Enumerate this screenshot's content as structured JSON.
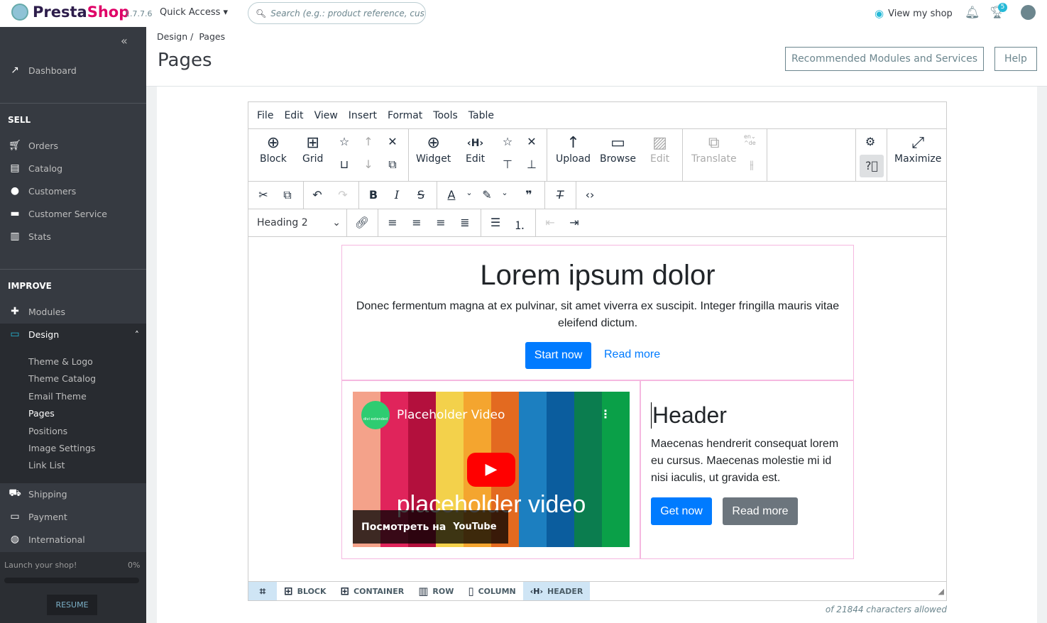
{
  "header": {
    "brand_a": "Presta",
    "brand_b": "Shop",
    "version": "1.7.7.6",
    "quick_access": "Quick Access",
    "search_placeholder": "Search (e.g.: product reference, customer name…)",
    "view_shop": "View my shop",
    "notif_count": "5"
  },
  "sidebar": {
    "dashboard": "Dashboard",
    "sell": "SELL",
    "sell_items": [
      "Orders",
      "Catalog",
      "Customers",
      "Customer Service",
      "Stats"
    ],
    "improve": "IMPROVE",
    "modules": "Modules",
    "design": "Design",
    "design_sub": [
      "Theme & Logo",
      "Theme Catalog",
      "Email Theme",
      "Pages",
      "Positions",
      "Image Settings",
      "Link List"
    ],
    "more": [
      "Shipping",
      "Payment",
      "International"
    ],
    "launch": "Launch your shop!",
    "launch_progress": "0%",
    "resume": "RESUME"
  },
  "page": {
    "breadcrumb_1": "Design",
    "breadcrumb_2": "Pages",
    "title": "Pages",
    "recommended": "Recommended Modules and Services",
    "help": "Help"
  },
  "editor": {
    "menu": [
      "File",
      "Edit",
      "View",
      "Insert",
      "Format",
      "Tools",
      "Table"
    ],
    "big": {
      "block": "Block",
      "grid": "Grid",
      "widget": "Widget",
      "edit": "Edit",
      "upload": "Upload",
      "browse": "Browse",
      "edit2": "Edit",
      "translate": "Translate",
      "maximize": "Maximize",
      "lang_from": "en",
      "lang_to": "de"
    },
    "format_select": "Heading 2",
    "content": {
      "title": "Lorem ipsum dolor",
      "text": "Donec fermentum magna at ex pulvinar, sit amet viverra ex suscipit. Integer fringilla mauris vitae eleifend dictum.",
      "start": "Start now",
      "read": "Read more",
      "video_title": "Placeholder Video",
      "video_caption": "placeholder video",
      "watch_on": "Посмотреть на",
      "youtube": "YouTube",
      "channel": "divi extended",
      "header": "Header",
      "header_text": "Maecenas hendrerit consequat lorem eu cursus. Maecenas molestie mi id nisi iaculis, ut gravida est.",
      "get": "Get now",
      "read2": "Read more"
    },
    "path": [
      "BLOCK",
      "CONTAINER",
      "ROW",
      "COLUMN",
      "HEADER"
    ],
    "chars": "of 21844 characters allowed"
  }
}
